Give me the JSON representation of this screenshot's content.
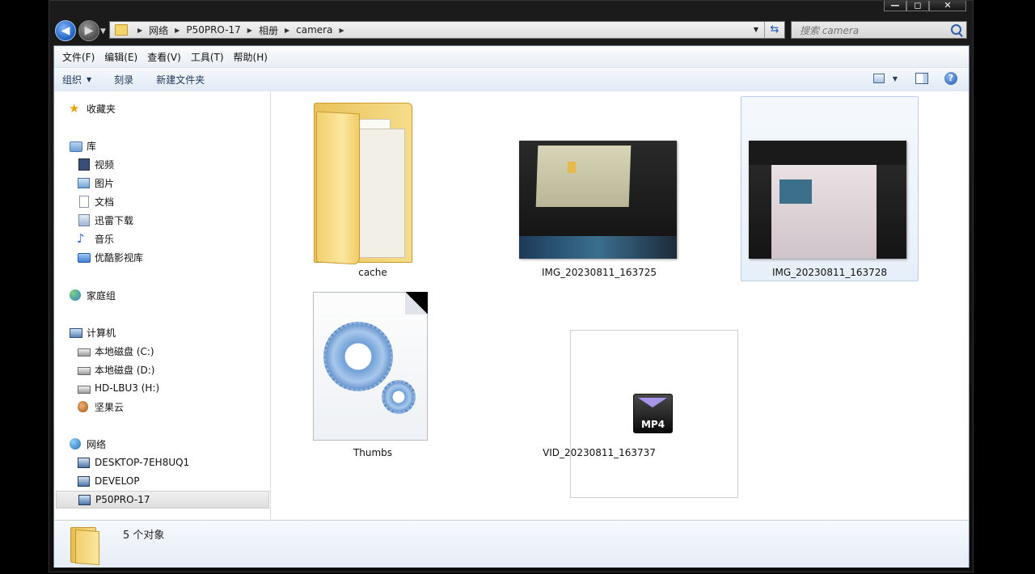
{
  "window": {
    "caption_buttons": [
      "—",
      "◻",
      "✕"
    ]
  },
  "address": {
    "crumbs": [
      "网络",
      "P50PRO-17",
      "相册",
      "camera"
    ]
  },
  "search": {
    "placeholder": "搜索 camera"
  },
  "menubar": {
    "items": [
      "文件(F)",
      "编辑(E)",
      "查看(V)",
      "工具(T)",
      "帮助(H)"
    ]
  },
  "toolbar": {
    "organize": "组织",
    "burn": "刻录",
    "new_folder": "新建文件夹",
    "help": "?"
  },
  "nav": {
    "favorites": "收藏夹",
    "libraries": "库",
    "library_items": [
      "视频",
      "图片",
      "文档",
      "迅雷下载",
      "音乐",
      "优酷影视库"
    ],
    "homegroup": "家庭组",
    "computer": "计算机",
    "computer_items": [
      "本地磁盘 (C:)",
      "本地磁盘 (D:)",
      "HD-LBU3 (H:)",
      "坚果云"
    ],
    "network": "网络",
    "network_items": [
      "DESKTOP-7EH8UQ1",
      "DEVELOP",
      "P50PRO-17"
    ],
    "selected": "P50PRO-17"
  },
  "files": [
    {
      "name": "cache",
      "type": "folder"
    },
    {
      "name": "IMG_20230811_163725",
      "type": "image"
    },
    {
      "name": "IMG_20230811_163728",
      "type": "image",
      "selected": true
    },
    {
      "name": "Thumbs",
      "type": "system-file"
    },
    {
      "name": "VID_20230811_163737",
      "type": "video",
      "badge": "MP4"
    }
  ],
  "details": {
    "count_text": "5 个对象"
  },
  "colors": {
    "selection_bg": "#e6eff9",
    "toolbar_text": "#1e395b",
    "folder": "#f2d06d"
  }
}
